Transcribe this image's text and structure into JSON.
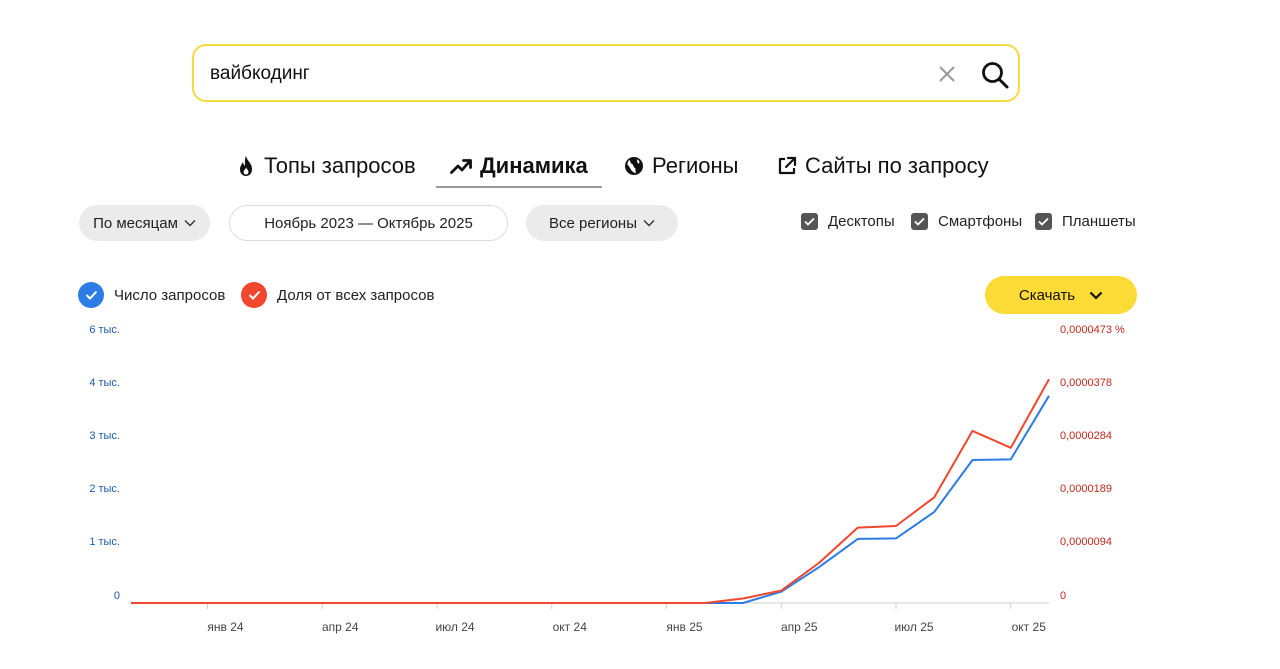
{
  "search": {
    "value": "вайбкодинг"
  },
  "tabs": [
    {
      "label": "Топы запросов",
      "icon": "fire-icon",
      "active": false
    },
    {
      "label": "Динамика",
      "icon": "trend-up-icon",
      "active": true
    },
    {
      "label": "Регионы",
      "icon": "globe-icon",
      "active": false
    },
    {
      "label": "Сайты по запросу",
      "icon": "external-link-icon",
      "active": false
    }
  ],
  "filters": {
    "grouping": "По месяцам",
    "period": "Ноябрь 2023 — Октябрь 2025",
    "region": "Все регионы",
    "devices": [
      {
        "label": "Десктопы",
        "checked": true
      },
      {
        "label": "Смартфоны",
        "checked": true
      },
      {
        "label": "Планшеты",
        "checked": true
      }
    ]
  },
  "legend": {
    "queries": {
      "label": "Число запросов",
      "color": "#2d7be5"
    },
    "share": {
      "label": "Доля от всех запросов",
      "color": "#f0472e"
    }
  },
  "download_label": "Скачать",
  "chart_data": {
    "type": "line",
    "x": [
      "2023-11",
      "2023-12",
      "2024-01",
      "2024-02",
      "2024-03",
      "2024-04",
      "2024-05",
      "2024-06",
      "2024-07",
      "2024-08",
      "2024-09",
      "2024-10",
      "2024-11",
      "2024-12",
      "2025-01",
      "2025-02",
      "2025-03",
      "2025-04",
      "2025-05",
      "2025-06",
      "2025-07",
      "2025-08",
      "2025-09",
      "2025-10"
    ],
    "x_tick_labels": [
      "янв 24",
      "апр 24",
      "июл 24",
      "окт 24",
      "янв 25",
      "апр 25",
      "июл 25",
      "окт 25"
    ],
    "left_axis": {
      "ticks": [
        "0",
        "1 тыс.",
        "2 тыс.",
        "3 тыс.",
        "4 тыс.",
        "6 тыс."
      ]
    },
    "right_axis": {
      "ticks": [
        "0",
        "0,0000094",
        "0,0000189",
        "0,0000284",
        "0,0000378",
        "0,0000473 %"
      ]
    },
    "series": [
      {
        "name": "Число запросов",
        "axis": "left",
        "color": "#2d7be5",
        "values": [
          0,
          0,
          0,
          0,
          0,
          0,
          0,
          0,
          0,
          0,
          0,
          0,
          0,
          0,
          0,
          0,
          0,
          210,
          670,
          1190,
          1200,
          1700,
          2680,
          2690,
          3890
        ]
      },
      {
        "name": "Доля от всех запросов",
        "axis": "right",
        "color": "#f0472e",
        "values": [
          0,
          0,
          0,
          0,
          0,
          0,
          0,
          0,
          0,
          0,
          0,
          0,
          0,
          0,
          0,
          0,
          8e-07,
          2.2e-06,
          7.2e-06,
          1.34e-05,
          1.37e-05,
          1.88e-05,
          3.06e-05,
          2.76e-05,
          3.98e-05
        ]
      }
    ]
  }
}
